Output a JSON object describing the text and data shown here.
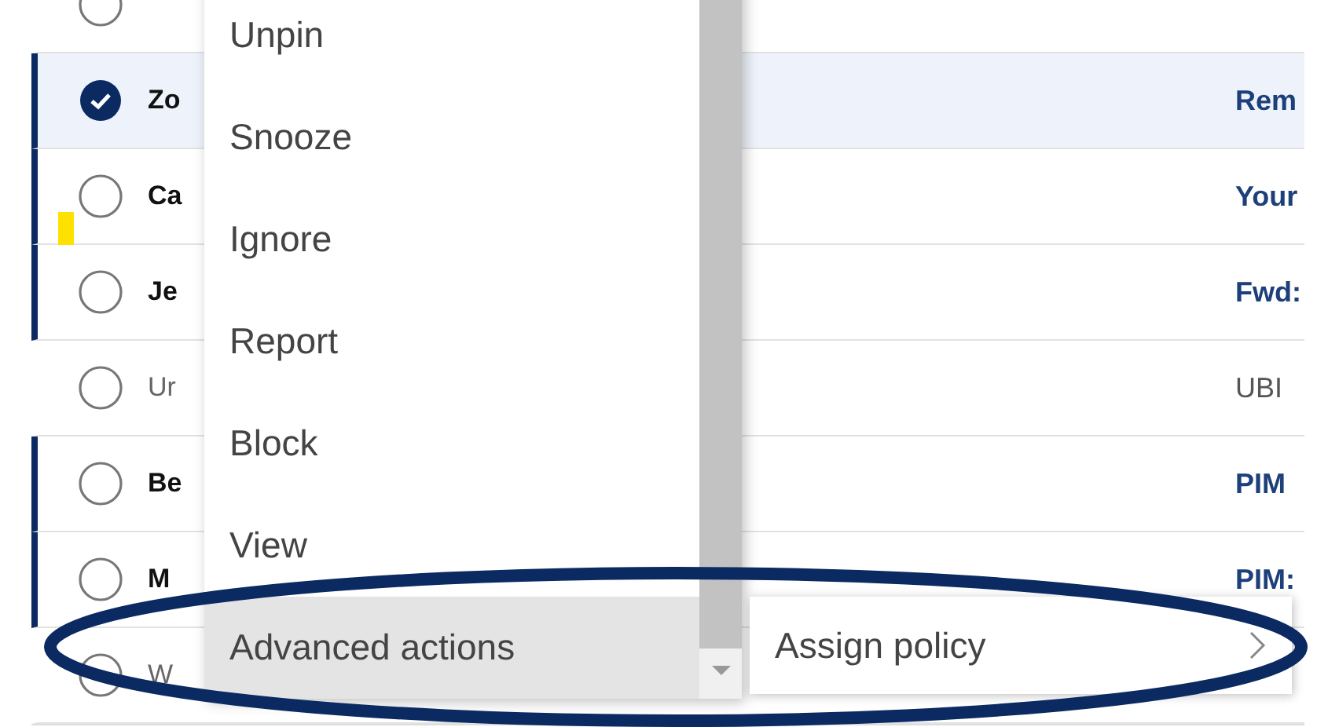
{
  "messages": [
    {
      "selected": false,
      "unread": false
    },
    {
      "sender": "Zo",
      "subject": "Rem",
      "selected": true,
      "unread": true
    },
    {
      "sender": "Ca",
      "subject": "Your",
      "selected": false,
      "unread": true
    },
    {
      "sender": "Je",
      "subject": "Fwd:",
      "selected": false,
      "unread": true
    },
    {
      "sender": "Ur",
      "subject": "UBI",
      "selected": false,
      "unread": false
    },
    {
      "sender": "Be",
      "subject": "PIM",
      "selected": false,
      "unread": true
    },
    {
      "sender": "M",
      "subject": "PIM:",
      "selected": false,
      "unread": true
    },
    {
      "sender": "W",
      "selected": false,
      "unread": false
    }
  ],
  "context_menu": {
    "items": [
      {
        "label": "Unpin",
        "selected": false
      },
      {
        "label": "Snooze",
        "selected": false
      },
      {
        "label": "Ignore",
        "selected": false
      },
      {
        "label": "Report",
        "selected": false
      },
      {
        "label": "Block",
        "selected": false
      },
      {
        "label": "View",
        "selected": false
      },
      {
        "label": "Advanced actions",
        "selected": true
      }
    ]
  },
  "submenu": {
    "items": [
      {
        "label": "Assign policy"
      }
    ]
  }
}
